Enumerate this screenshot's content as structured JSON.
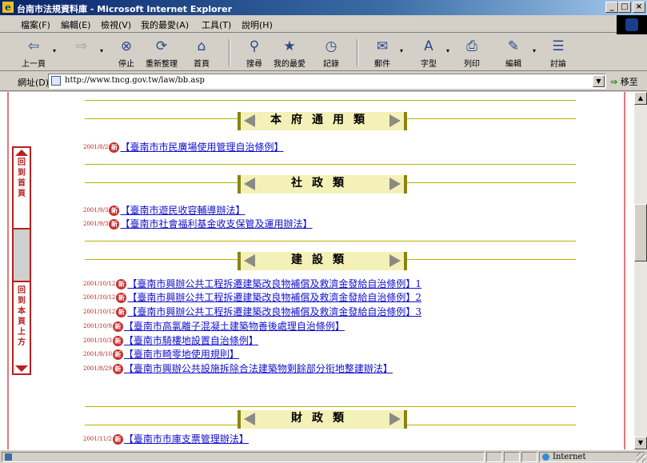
{
  "window": {
    "title": "台南市法規資料庫 - Microsoft Internet Explorer",
    "min_glyph": "_",
    "max_glyph": "□",
    "close_glyph": "×"
  },
  "menu": [
    "檔案(F)",
    "編輯(E)",
    "檢視(V)",
    "我的最愛(A)",
    "工具(T)",
    "說明(H)"
  ],
  "toolbar": {
    "back": {
      "label": "上一頁",
      "icon": "⇦"
    },
    "forward": {
      "icon": "⇨"
    },
    "stop": {
      "label": "停止",
      "icon": "⊗"
    },
    "refresh": {
      "label": "重新整理",
      "icon": "⟳"
    },
    "home": {
      "label": "首頁",
      "icon": "⌂"
    },
    "search": {
      "label": "搜尋",
      "icon": "⚲"
    },
    "favorites": {
      "label": "我的最愛",
      "icon": "★"
    },
    "history": {
      "label": "記錄",
      "icon": "◷"
    },
    "mail": {
      "label": "郵件",
      "icon": "✉"
    },
    "font": {
      "label": "字型",
      "icon": "A"
    },
    "print": {
      "label": "列印",
      "icon": "⎙"
    },
    "edit": {
      "label": "編輯",
      "icon": "✎"
    },
    "discuss": {
      "label": "討論",
      "icon": "☰"
    },
    "dropdown_glyph": "▾"
  },
  "address": {
    "label": "網址(D)",
    "url": "http://www.tncg.gov.tw/law/bb.asp",
    "go_label": "移至",
    "go_arrow": "⇒",
    "dropdown_glyph": "▼"
  },
  "side_nav": {
    "back_home": "回到首頁",
    "back_top": "回到本頁上方"
  },
  "new_badge": "新",
  "sections": [
    {
      "title": "本府通用類",
      "entries": [
        {
          "date": "2001/8/2",
          "text": "【臺南市市民廣場使用管理自治條例】"
        }
      ]
    },
    {
      "title": "社政類",
      "entries": [
        {
          "date": "2001/9/3",
          "text": "【臺南市遊民收容輔導辦法】"
        },
        {
          "date": "2001/9/3",
          "text": "【臺南市社會福利基金收支保管及運用辦法】"
        }
      ]
    },
    {
      "title": "建設類",
      "entries": [
        {
          "date": "2001/10/12",
          "text": "【臺南市興辦公共工程拆遷建築改良物補償及救濟金發給自治條例】1"
        },
        {
          "date": "2001/10/12",
          "text": "【臺南市興辦公共工程拆遷建築改良物補償及救濟金發給自治條例】2"
        },
        {
          "date": "2001/10/12",
          "text": "【臺南市興辦公共工程拆遷建築改良物補償及救濟金發給自治條例】3"
        },
        {
          "date": "2001/10/9",
          "text": "【臺南市高氯離子混凝土建築物善後處理自治條例】"
        },
        {
          "date": "2001/10/3",
          "text": "【臺南市騎樓地設置自治條例】"
        },
        {
          "date": "2001/8/10",
          "text": "【臺南市畸零地使用規則】"
        },
        {
          "date": "2001/8/29",
          "text": "【臺南市興辦公共設施拆除合法建築物剩餘部分衔地整建辦法】"
        }
      ]
    },
    {
      "title": "財政類",
      "entries": [
        {
          "date": "2001/11/2",
          "text": "【臺南市市庫支票管理辦法】"
        }
      ]
    }
  ],
  "status": {
    "zone": "Internet"
  },
  "scrollbar": {
    "up_glyph": "▲",
    "down_glyph": "▼"
  }
}
